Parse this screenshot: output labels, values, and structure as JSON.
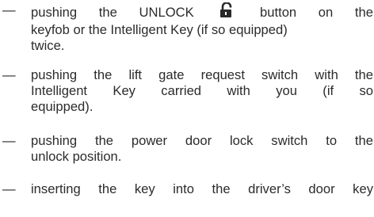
{
  "list_marker": "—",
  "items": [
    {
      "lines": [
        {
          "before_icon": "pushing the UNLOCK",
          "after_icon": "button on the"
        },
        "keyfob or the Intelligent Key (if so equipped)",
        "twice."
      ],
      "icon": "unlock-icon"
    },
    {
      "lines": [
        "pushing the lift gate request switch with the",
        "Intelligent Key carried with you (if so",
        "equipped)."
      ]
    },
    {
      "lines": [
        "pushing the power door lock switch to the",
        "unlock position."
      ]
    },
    {
      "lines": [
        "inserting the key into the driver’s door key"
      ]
    }
  ]
}
